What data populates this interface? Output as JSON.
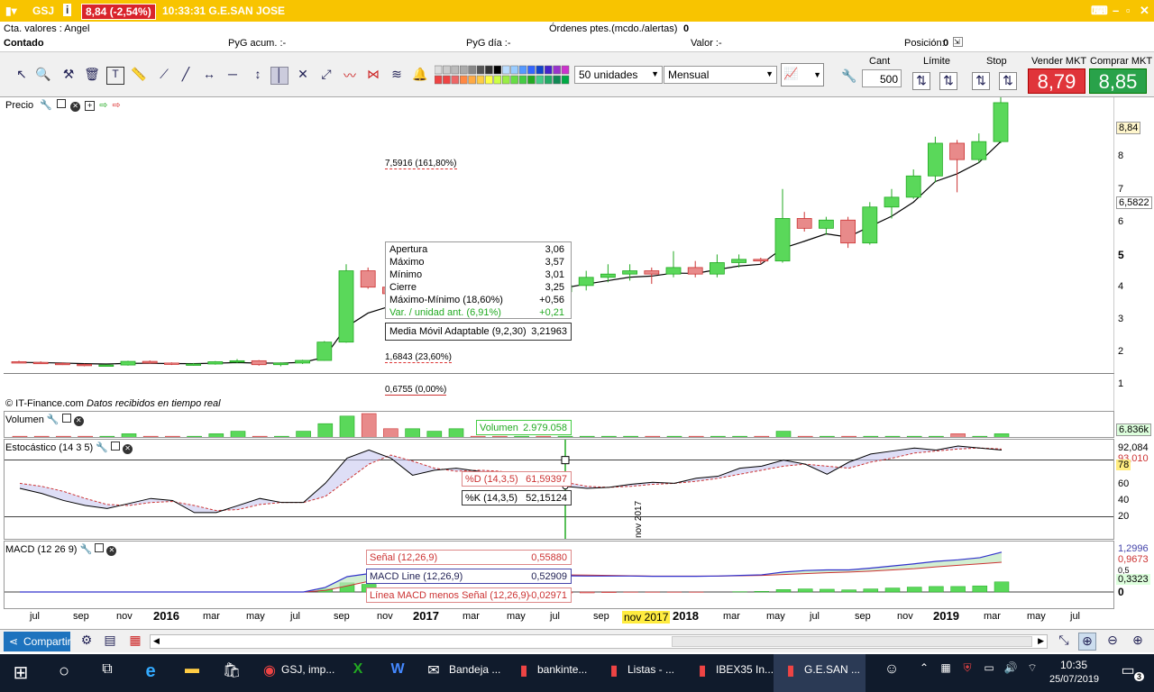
{
  "title_bar": {
    "ticker": "GSJ",
    "price_badge": "8,84 (-2,54%)",
    "time_name": "10:33:31 G.E.SAN JOSE"
  },
  "info": {
    "account": "Cta. valores : Angel",
    "mode": "Contado",
    "orders_label": "Órdenes ptes.(mcdo./alertas)",
    "orders_value": "0",
    "pyg_acum": "PyG acum. :-",
    "pyg_dia": "PyG día :-",
    "valor": "Valor :-",
    "posicion": "Posición:",
    "posicion_value": "0"
  },
  "toolbar": {
    "units": "50 unidades",
    "period": "Mensual",
    "cant_label": "Cant",
    "cant_value": "500",
    "limite_label": "Límite",
    "stop_label": "Stop",
    "sell_label": "Vender MKT",
    "buy_label": "Comprar MKT",
    "sell_price": "8,79",
    "buy_price": "8,85"
  },
  "price_panel": {
    "label": "Precio",
    "credit": "© IT-Finance.com",
    "credit2": "Datos recibidos en tiempo real",
    "y_ticks": [
      "8",
      "7",
      "6",
      "5",
      "4",
      "3",
      "2",
      "1"
    ],
    "last_price": "8,84",
    "ma_value": "6,5822",
    "fib": [
      "7,5916 (161,80%)",
      "1,6843 (23,60%)",
      "0,6755 (0,00%)"
    ],
    "tooltip": {
      "rows": [
        [
          "Apertura",
          "3,06"
        ],
        [
          "Máximo",
          "3,57"
        ],
        [
          "Mínimo",
          "3,01"
        ],
        [
          "Cierre",
          "3,25"
        ],
        [
          "Máximo-Mínimo (18,60%)",
          "+0,56"
        ],
        [
          "Var. / unidad ant. (6,91%)",
          "+0,21"
        ]
      ],
      "ma": "Media Móvil Adaptable (9,2,30)",
      "ma_val": "3,21963"
    }
  },
  "volume_panel": {
    "label": "Volumen",
    "tooltip": "Volumen",
    "tooltip_val": "2.979.058",
    "axis": "6.836k"
  },
  "stoch_panel": {
    "label": "Estocástico (14 3 5)",
    "d_label": "%D (14,3,5)",
    "d_val": "61,59397",
    "k_label": "%K (14,3,5)",
    "k_val": "52,15124",
    "y_ticks": [
      "92,084",
      "93,010",
      "78",
      "60",
      "40",
      "20"
    ],
    "vline": "nov 2017"
  },
  "macd_panel": {
    "label": "MACD (12 26 9)",
    "signal": "Señal (12,26,9)",
    "signal_val": "0,55880",
    "line": "MACD Line (12,26,9)",
    "line_val": "0,52909",
    "hist": "Línea MACD menos Señal (12,26,9)",
    "hist_val": "-0,02971",
    "y_ticks": [
      "1,2996",
      "0,9673",
      "0,5",
      "0,3323",
      "0"
    ]
  },
  "x_axis": [
    "jul",
    "sep",
    "nov",
    "2016",
    "mar",
    "may",
    "jul",
    "sep",
    "nov",
    "2017",
    "mar",
    "may",
    "jul",
    "sep",
    "nov 2017",
    "2018",
    "mar",
    "may",
    "jul",
    "sep",
    "nov",
    "2019",
    "mar",
    "may",
    "jul"
  ],
  "bottom": {
    "share": "Compartir"
  },
  "taskbar": {
    "items": [
      "GSJ, imp...",
      "Bandeja ...",
      "bankinte...",
      "Listas - ...",
      "IBEX35 In...",
      "G.E.SAN ..."
    ],
    "time": "10:35",
    "date": "25/07/2019"
  },
  "colors": {
    "title": "#f8c400",
    "up": "#4ccb4c",
    "down": "#e88a8a",
    "sell": "#e0343a",
    "buy": "#29a24a"
  },
  "chart_data": {
    "type": "candlestick",
    "period": "monthly",
    "candles": [
      [
        0.92,
        0.95,
        0.88,
        0.9
      ],
      [
        0.9,
        0.93,
        0.85,
        0.87
      ],
      [
        0.87,
        0.9,
        0.82,
        0.84
      ],
      [
        0.84,
        0.86,
        0.78,
        0.8
      ],
      [
        0.8,
        0.84,
        0.77,
        0.82
      ],
      [
        0.82,
        0.95,
        0.8,
        0.93
      ],
      [
        0.93,
        0.96,
        0.86,
        0.88
      ],
      [
        0.88,
        0.9,
        0.82,
        0.84
      ],
      [
        0.84,
        0.88,
        0.8,
        0.85
      ],
      [
        0.85,
        0.94,
        0.83,
        0.92
      ],
      [
        0.92,
        1.0,
        0.88,
        0.95
      ],
      [
        0.95,
        0.97,
        0.8,
        0.83
      ],
      [
        0.83,
        0.9,
        0.78,
        0.88
      ],
      [
        0.88,
        0.98,
        0.85,
        0.96
      ],
      [
        0.96,
        1.55,
        0.95,
        1.52
      ],
      [
        1.52,
        3.9,
        1.5,
        3.7
      ],
      [
        3.7,
        3.8,
        3.15,
        3.2
      ],
      [
        3.2,
        3.4,
        2.9,
        3.0
      ],
      [
        3.0,
        3.3,
        2.7,
        3.1
      ],
      [
        3.1,
        3.2,
        2.9,
        3.2
      ],
      [
        3.2,
        3.8,
        3.1,
        3.35
      ],
      [
        3.35,
        3.5,
        3.1,
        3.25
      ],
      [
        3.25,
        3.35,
        3.0,
        3.1
      ],
      [
        3.1,
        3.5,
        3.0,
        3.4
      ],
      [
        3.4,
        3.6,
        2.8,
        3.0
      ],
      [
        3.06,
        3.57,
        3.01,
        3.25
      ],
      [
        3.25,
        3.7,
        3.1,
        3.5
      ],
      [
        3.5,
        3.9,
        3.35,
        3.6
      ],
      [
        3.6,
        3.9,
        3.4,
        3.7
      ],
      [
        3.7,
        3.8,
        3.3,
        3.6
      ],
      [
        3.6,
        4.3,
        3.5,
        3.8
      ],
      [
        3.8,
        4.0,
        3.5,
        3.6
      ],
      [
        3.6,
        4.2,
        3.5,
        3.95
      ],
      [
        3.95,
        4.2,
        3.8,
        4.05
      ],
      [
        4.05,
        4.1,
        3.9,
        4.0
      ],
      [
        4.0,
        6.2,
        3.95,
        5.3
      ],
      [
        5.3,
        5.5,
        4.9,
        5.0
      ],
      [
        5.0,
        5.35,
        4.8,
        5.25
      ],
      [
        5.25,
        5.35,
        4.4,
        4.55
      ],
      [
        4.55,
        5.8,
        4.5,
        5.65
      ],
      [
        5.65,
        6.2,
        5.3,
        5.95
      ],
      [
        5.95,
        6.8,
        5.9,
        6.6
      ],
      [
        6.6,
        7.8,
        6.4,
        7.6
      ],
      [
        7.6,
        7.7,
        6.1,
        7.1
      ],
      [
        7.1,
        7.9,
        7.0,
        7.65
      ],
      [
        7.65,
        9.2,
        7.6,
        8.84
      ]
    ]
  }
}
